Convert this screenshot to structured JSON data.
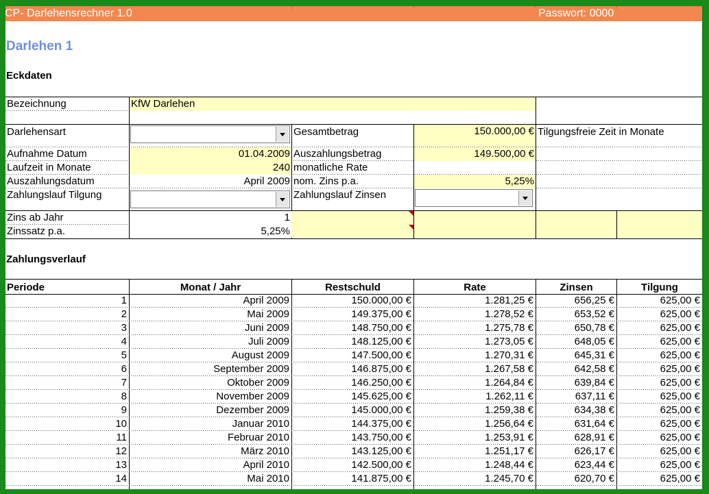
{
  "titlebar": {
    "app_title": "CP- Darlehensrechner 1.0",
    "password_label": "Passwort: 0000"
  },
  "heading": "Darlehen 1",
  "sections": {
    "eckdaten": "Eckdaten",
    "zahlungsverlauf": "Zahlungsverlauf"
  },
  "eckdaten": {
    "bezeichnung_label": "Bezeichnung",
    "bezeichnung_value": "KfW Darlehen",
    "darlehensart_label": "Darlehensart",
    "darlehensart_value": "",
    "gesamtbetrag_label": "Gesamtbetrag",
    "gesamtbetrag_value": "150.000,00 €",
    "tilgungsfreie_label": "Tilgungsfreie Zeit in Monate",
    "aufnahme_label": "Aufnahme Datum",
    "aufnahme_value": "01.04.2009",
    "auszahlungsbetrag_label": "Auszahlungsbetrag",
    "auszahlungsbetrag_value": "149.500,00 €",
    "laufzeit_label": "Laufzeit in Monate",
    "laufzeit_value": "240",
    "monatliche_rate_label": "monatliche Rate",
    "auszahlungsdatum_label": "Auszahlungsdatum",
    "auszahlungsdatum_value": "April 2009",
    "nom_zins_label": "nom. Zins p.a.",
    "nom_zins_value": "5,25%",
    "zahlungslauf_tilgung_label": "Zahlungslauf Tilgung",
    "zahlungslauf_zinsen_label": "Zahlungslauf Zinsen",
    "zins_ab_jahr_label": "Zins ab Jahr",
    "zins_ab_jahr_value": "1",
    "zinssatz_label": "Zinssatz p.a.",
    "zinssatz_value": "5,25%"
  },
  "table": {
    "headers": [
      "Periode",
      "Monat / Jahr",
      "Restschuld",
      "Rate",
      "Zinsen",
      "Tilgung"
    ],
    "rows": [
      [
        "1",
        "April 2009",
        "150.000,00 €",
        "1.281,25 €",
        "656,25 €",
        "625,00 €"
      ],
      [
        "2",
        "Mai 2009",
        "149.375,00 €",
        "1.278,52 €",
        "653,52 €",
        "625,00 €"
      ],
      [
        "3",
        "Juni 2009",
        "148.750,00 €",
        "1.275,78 €",
        "650,78 €",
        "625,00 €"
      ],
      [
        "4",
        "Juli 2009",
        "148.125,00 €",
        "1.273,05 €",
        "648,05 €",
        "625,00 €"
      ],
      [
        "5",
        "August 2009",
        "147.500,00 €",
        "1.270,31 €",
        "645,31 €",
        "625,00 €"
      ],
      [
        "6",
        "September 2009",
        "146.875,00 €",
        "1.267,58 €",
        "642,58 €",
        "625,00 €"
      ],
      [
        "7",
        "Oktober 2009",
        "146.250,00 €",
        "1.264,84 €",
        "639,84 €",
        "625,00 €"
      ],
      [
        "8",
        "November 2009",
        "145.625,00 €",
        "1.262,11 €",
        "637,11 €",
        "625,00 €"
      ],
      [
        "9",
        "Dezember 2009",
        "145.000,00 €",
        "1.259,38 €",
        "634,38 €",
        "625,00 €"
      ],
      [
        "10",
        "Januar 2010",
        "144.375,00 €",
        "1.256,64 €",
        "631,64 €",
        "625,00 €"
      ],
      [
        "11",
        "Februar 2010",
        "143.750,00 €",
        "1.253,91 €",
        "628,91 €",
        "625,00 €"
      ],
      [
        "12",
        "März 2010",
        "143.125,00 €",
        "1.251,17 €",
        "626,17 €",
        "625,00 €"
      ],
      [
        "13",
        "April 2010",
        "142.500,00 €",
        "1.248,44 €",
        "623,44 €",
        "625,00 €"
      ],
      [
        "14",
        "Mai 2010",
        "141.875,00 €",
        "1.245,70 €",
        "620,70 €",
        "625,00 €"
      ]
    ]
  },
  "colors": {
    "titlebar": "#f2884f",
    "input_cell": "#ffffc4",
    "heading": "#6d8ee0",
    "frame": "#1a8a1a"
  }
}
